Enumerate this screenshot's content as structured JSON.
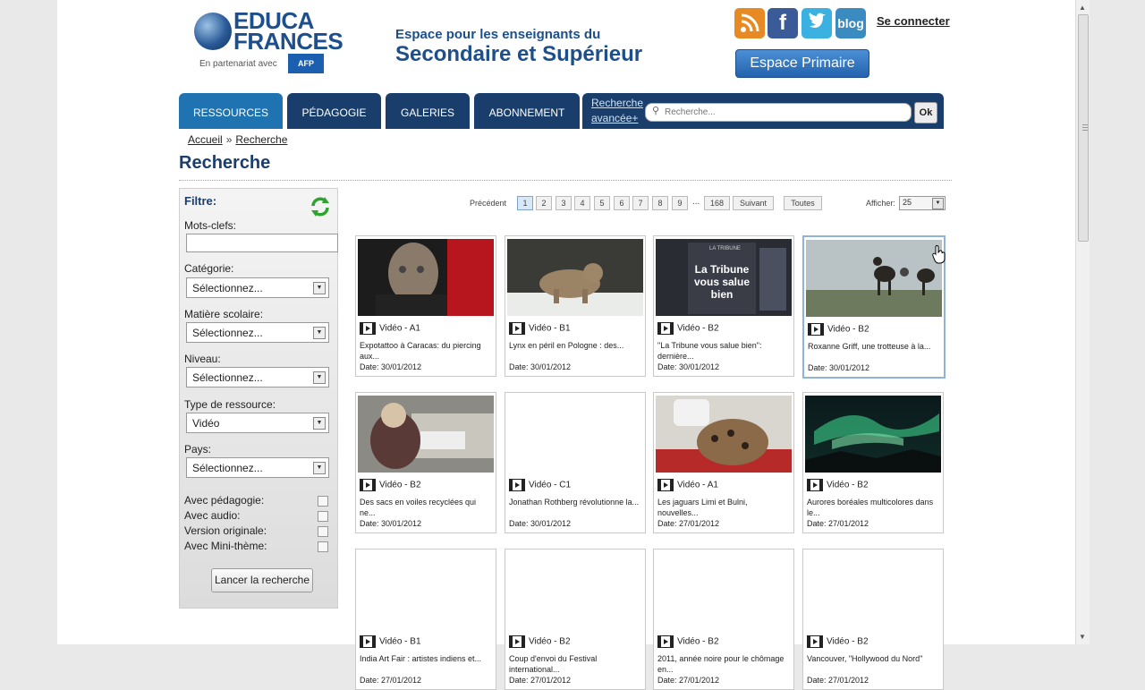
{
  "header": {
    "logo_line1": "EDUCA",
    "logo_line2": "FRANCES",
    "partner_text": "En partenariat avec",
    "partner_logo": "AFP",
    "tagline1": "Espace pour les enseignants du",
    "tagline2": "Secondaire et Supérieur",
    "social": [
      "rss-icon",
      "facebook-icon",
      "twitter-icon",
      "blog-icon"
    ],
    "facebook_glyph": "f",
    "blog_label": "blog",
    "connect": "Se connecter",
    "primaire_button": "Espace Primaire"
  },
  "nav": {
    "tabs": [
      "RESSOURCES",
      "PÉDAGOGIE",
      "GALERIES",
      "ABONNEMENT"
    ],
    "active_tab": "RESSOURCES",
    "advanced_line1": "Recherche",
    "advanced_line2": "avancée+",
    "search_placeholder": "Recherche...",
    "ok_label": "Ok"
  },
  "breadcrumb": {
    "home": "Accueil",
    "sep": "»",
    "current": "Recherche"
  },
  "page_title": "Recherche",
  "filter": {
    "title": "Filtre:",
    "keywords_label": "Mots-clefs:",
    "selects": [
      {
        "label": "Catégorie:",
        "value": "Sélectionnez..."
      },
      {
        "label": "Matière scolaire:",
        "value": "Sélectionnez..."
      },
      {
        "label": "Niveau:",
        "value": "Sélectionnez..."
      },
      {
        "label": "Type de ressource:",
        "value": "Vidéo"
      },
      {
        "label": "Pays:",
        "value": "Sélectionnez..."
      }
    ],
    "checkboxes": [
      "Avec pédagogie:",
      "Avec audio:",
      "Version originale:",
      "Avec Mini-thème:"
    ],
    "submit": "Lancer la recherche"
  },
  "pagination": {
    "prev": "Précédent",
    "pages": [
      "1",
      "2",
      "3",
      "4",
      "5",
      "6",
      "7",
      "8",
      "9"
    ],
    "current": "1",
    "ellipsis": "...",
    "last": "168",
    "next": "Suivant",
    "all": "Toutes",
    "show_label": "Afficher:",
    "show_value": "25"
  },
  "cards": [
    {
      "media": "Vidéo - A1",
      "desc": "Expotattoo à Caracas: du piercing aux...",
      "date": "Date: 30/01/2012",
      "thumb": "tattoo"
    },
    {
      "media": "Vidéo - B1",
      "desc": "Lynx en péril en Pologne : des...",
      "date": "Date: 30/01/2012",
      "thumb": "lynx"
    },
    {
      "media": "Vidéo - B2",
      "desc": "\"La Tribune vous salue bien\": dernière...",
      "date": "Date: 30/01/2012",
      "thumb": "tribune",
      "thumb_header": "LA TRIBUNE",
      "thumb_text1": "La Tribune",
      "thumb_text2": "vous salue",
      "thumb_text3": "bien"
    },
    {
      "media": "Vidéo - B2",
      "desc": "Roxanne Griff, une trotteuse à la...",
      "date": "Date: 30/01/2012",
      "thumb": "horses",
      "highlight": true
    },
    {
      "media": "Vidéo - B2",
      "desc": "Des sacs en voiles recyclées qui ne...",
      "date": "Date: 30/01/2012",
      "thumb": "sewing"
    },
    {
      "media": "Vidéo - C1",
      "desc": "Jonathan Rothberg révolutionne la...",
      "date": "Date: 30/01/2012",
      "thumb": "none"
    },
    {
      "media": "Vidéo - A1",
      "desc": "Les jaguars Limi et Bulni, nouvelles...",
      "date": "Date: 27/01/2012",
      "thumb": "jaguar"
    },
    {
      "media": "Vidéo - B2",
      "desc": "Aurores boréales multicolores dans le...",
      "date": "Date: 27/01/2012",
      "thumb": "aurora"
    },
    {
      "media": "Vidéo - B1",
      "desc": "India Art Fair : artistes indiens et...",
      "date": "Date: 27/01/2012",
      "thumb": "none"
    },
    {
      "media": "Vidéo - B2",
      "desc": "Coup d'envoi du Festival international...",
      "date": "Date: 27/01/2012",
      "thumb": "none"
    },
    {
      "media": "Vidéo - B2",
      "desc": "2011, année noire pour le chômage en...",
      "date": "Date: 27/01/2012",
      "thumb": "none"
    },
    {
      "media": "Vidéo - B2",
      "desc": "Vancouver, \"Hollywood du Nord\"",
      "date": "Date: 27/01/2012",
      "thumb": "none"
    }
  ]
}
